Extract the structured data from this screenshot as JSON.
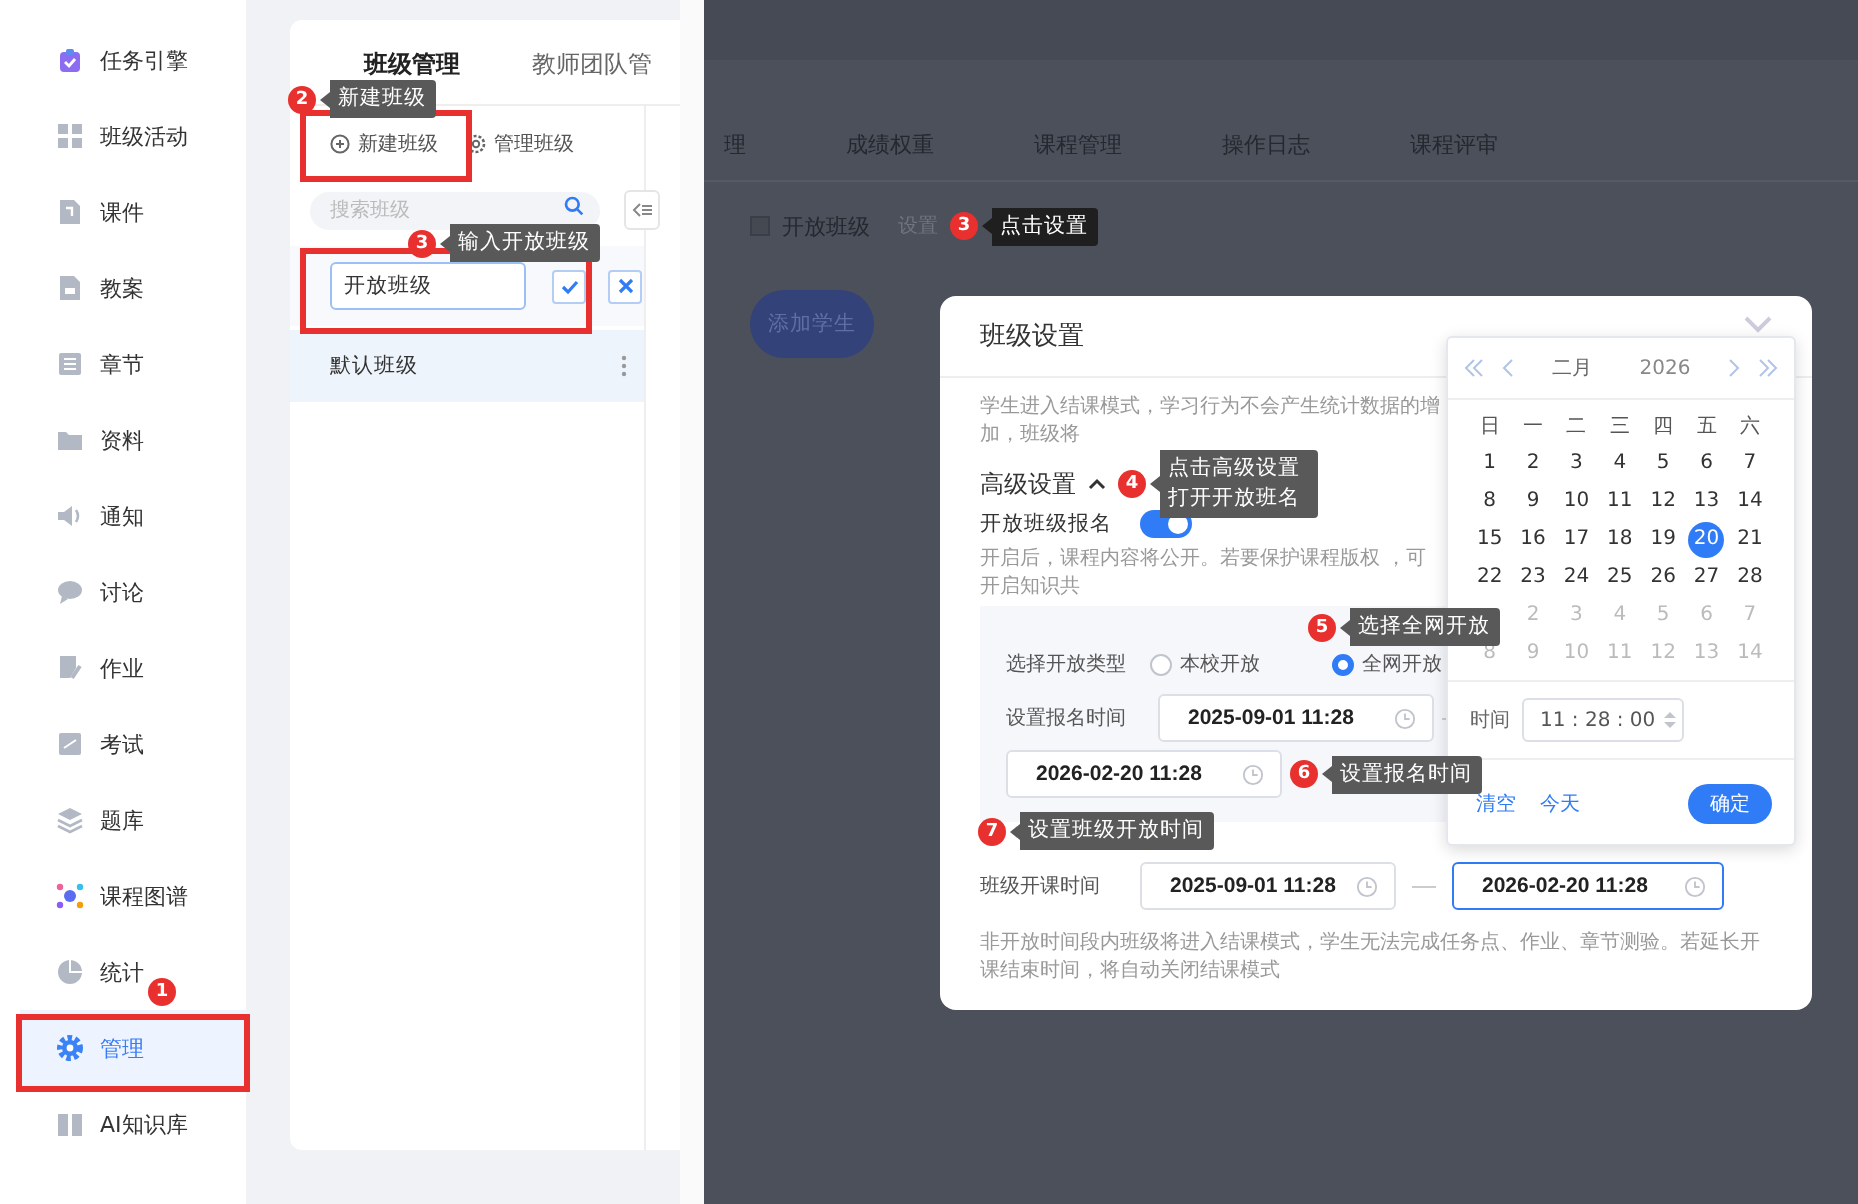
{
  "sidebar": {
    "items": [
      {
        "label": "任务引擎",
        "selected": false
      },
      {
        "label": "班级活动",
        "selected": false
      },
      {
        "label": "课件",
        "selected": false
      },
      {
        "label": "教案",
        "selected": false
      },
      {
        "label": "章节",
        "selected": false
      },
      {
        "label": "资料",
        "selected": false
      },
      {
        "label": "通知",
        "selected": false
      },
      {
        "label": "讨论",
        "selected": false
      },
      {
        "label": "作业",
        "selected": false
      },
      {
        "label": "考试",
        "selected": false
      },
      {
        "label": "题库",
        "selected": false
      },
      {
        "label": "课程图谱",
        "selected": false
      },
      {
        "label": "统计",
        "selected": false
      },
      {
        "label": "管理",
        "selected": true
      },
      {
        "label": "AI知识库",
        "selected": false
      }
    ]
  },
  "class_panel": {
    "tabs": [
      {
        "label": "班级管理",
        "selected": true
      },
      {
        "label": "教师团队管",
        "selected": false
      }
    ],
    "actions": [
      "新建班级",
      "管理班级"
    ],
    "search": {
      "placeholder": "搜索班级"
    },
    "new_class_input": {
      "value": "开放班级"
    },
    "classes": [
      {
        "label": "默认班级",
        "selected": true
      }
    ]
  },
  "course_page": {
    "tabs": [
      "理",
      "成绩权重",
      "课程管理",
      "操作日志",
      "课程评审"
    ],
    "open_class": {
      "checked": false,
      "label": "开放班级",
      "settings_link": "设置"
    },
    "add_student_button": "添加学生"
  },
  "dialog": {
    "title": "班级设置",
    "description": "学生进入结课模式，学习行为不会产生统计数据的增加，班级将",
    "advanced": {
      "label": "高级设置",
      "expanded": true
    },
    "open_enrollment": {
      "label": "开放班级报名",
      "on": true,
      "hint": "开启后，课程内容将公开。若要保护课程版权 ，可开启知识共"
    },
    "open_type": {
      "label": "选择开放类型",
      "options": [
        {
          "label": "本校开放",
          "selected": false
        },
        {
          "label": "全网开放",
          "selected": true
        }
      ]
    },
    "enrollment_time": {
      "label": "设置报名时间",
      "start": "2025-09-01 11:28",
      "end": "2026-02-20 11:28"
    },
    "class_time": {
      "label": "班级开课时间",
      "start": "2025-09-01 11:28",
      "end": "2026-02-20 11:28"
    },
    "note": "非开放时间段内班级将进入结课模式，学生无法完成任务点、作业、章节测验。若延长开课结束时间，将自动关闭结课模式"
  },
  "date_picker": {
    "month": "二月",
    "year": "2026",
    "weekdays": [
      "日",
      "一",
      "二",
      "三",
      "四",
      "五",
      "六"
    ],
    "days": [
      {
        "text": "1",
        "outside": false,
        "selected": false
      },
      {
        "text": "2",
        "outside": false,
        "selected": false
      },
      {
        "text": "3",
        "outside": false,
        "selected": false
      },
      {
        "text": "4",
        "outside": false,
        "selected": false
      },
      {
        "text": "5",
        "outside": false,
        "selected": false
      },
      {
        "text": "6",
        "outside": false,
        "selected": false
      },
      {
        "text": "7",
        "outside": false,
        "selected": false
      },
      {
        "text": "8",
        "outside": false,
        "selected": false
      },
      {
        "text": "9",
        "outside": false,
        "selected": false
      },
      {
        "text": "10",
        "outside": false,
        "selected": false
      },
      {
        "text": "11",
        "outside": false,
        "selected": false
      },
      {
        "text": "12",
        "outside": false,
        "selected": false
      },
      {
        "text": "13",
        "outside": false,
        "selected": false
      },
      {
        "text": "14",
        "outside": false,
        "selected": false
      },
      {
        "text": "15",
        "outside": false,
        "selected": false
      },
      {
        "text": "16",
        "outside": false,
        "selected": false
      },
      {
        "text": "17",
        "outside": false,
        "selected": false
      },
      {
        "text": "18",
        "outside": false,
        "selected": false
      },
      {
        "text": "19",
        "outside": false,
        "selected": false
      },
      {
        "text": "20",
        "outside": false,
        "selected": true
      },
      {
        "text": "21",
        "outside": false,
        "selected": false
      },
      {
        "text": "22",
        "outside": false,
        "selected": false
      },
      {
        "text": "23",
        "outside": false,
        "selected": false
      },
      {
        "text": "24",
        "outside": false,
        "selected": false
      },
      {
        "text": "25",
        "outside": false,
        "selected": false
      },
      {
        "text": "26",
        "outside": false,
        "selected": false
      },
      {
        "text": "27",
        "outside": false,
        "selected": false
      },
      {
        "text": "28",
        "outside": false,
        "selected": false
      },
      {
        "selected": false
      },
      {
        "text": "2",
        "outside": true,
        "selected": false
      },
      {
        "text": "3",
        "outside": true,
        "selected": false
      },
      {
        "text": "4",
        "outside": true,
        "selected": false
      },
      {
        "text": "5",
        "outside": true,
        "selected": false
      },
      {
        "text": "6",
        "outside": true,
        "selected": false
      },
      {
        "text": "7",
        "outside": true,
        "selected": false
      },
      {
        "text": "8",
        "outside": true,
        "selected": false
      },
      {
        "text": "9",
        "outside": true,
        "selected": false
      },
      {
        "text": "10",
        "outside": true,
        "selected": false
      },
      {
        "text": "11",
        "outside": true,
        "selected": false
      },
      {
        "text": "12",
        "outside": true,
        "selected": false
      },
      {
        "text": "13",
        "outside": true,
        "selected": false
      },
      {
        "text": "14",
        "outside": true,
        "selected": false
      }
    ],
    "time_label": "时间",
    "time": "11 : 28 : 00",
    "clear": "清空",
    "today": "今天",
    "confirm": "确定"
  },
  "annotations": [
    {
      "number": "1"
    },
    {
      "number": "2",
      "text": "新建班级"
    },
    {
      "number": "3",
      "text": "输入开放班级"
    },
    {
      "number": "3",
      "text": "点击设置"
    },
    {
      "number": "4",
      "text": "点击高级设置打开开放班名"
    },
    {
      "number": "5",
      "text": "选择全网开放"
    },
    {
      "number": "6",
      "text": "设置报名时间"
    },
    {
      "number": "7",
      "text": "设置班级开放时间"
    }
  ]
}
